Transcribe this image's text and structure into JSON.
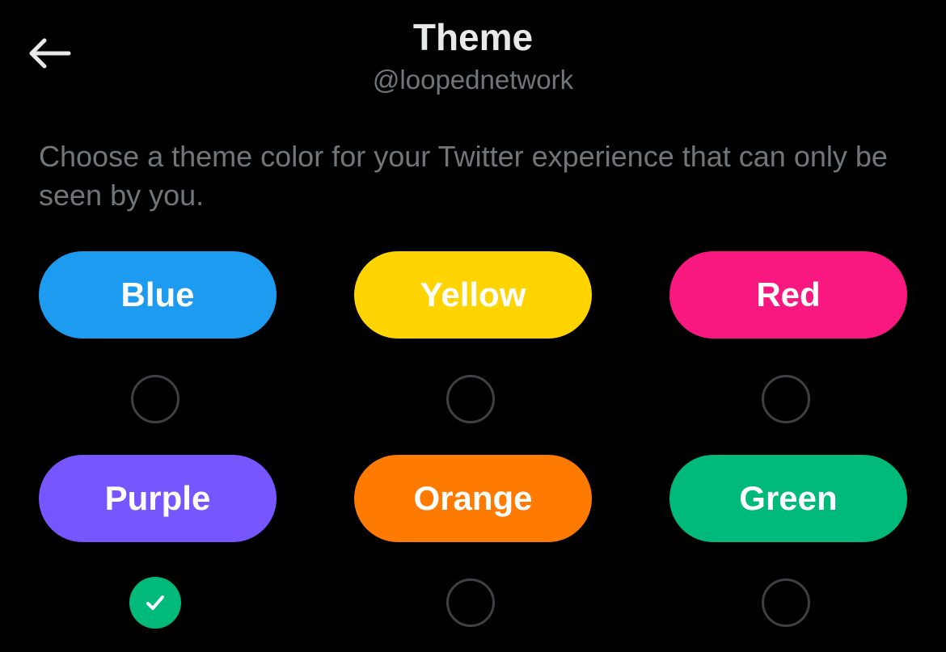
{
  "header": {
    "title": "Theme",
    "subtitle": "@loopednetwork"
  },
  "description": "Choose a theme color for your Twitter experience that can only be seen by you.",
  "themes": [
    {
      "label": "Blue",
      "color": "#1d9bf0",
      "selected": false
    },
    {
      "label": "Yellow",
      "color": "#ffd400",
      "selected": false
    },
    {
      "label": "Red",
      "color": "#f91880",
      "selected": false
    },
    {
      "label": "Purple",
      "color": "#7856ff",
      "selected": true
    },
    {
      "label": "Orange",
      "color": "#ff7a00",
      "selected": false
    },
    {
      "label": "Green",
      "color": "#00ba7c",
      "selected": false
    }
  ],
  "icons": {
    "back": "arrow-left-icon",
    "check": "check-icon"
  },
  "colors": {
    "background": "#000000",
    "primary_text": "#e7e9ea",
    "secondary_text": "#71767b",
    "radio_border": "#3e4144",
    "check_fill": "#00ba7c"
  }
}
